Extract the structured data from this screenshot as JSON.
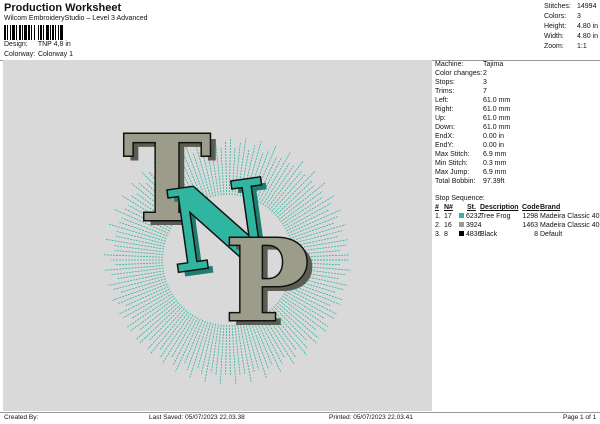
{
  "header": {
    "title": "Production Worksheet",
    "subtitle": "Wilcom EmbroideryStudio – Level 3 Advanced",
    "design_label": "Design:",
    "design_value": "TNP 4,8 in",
    "colorway_label": "Colorway:",
    "colorway_value": "Colorway 1"
  },
  "stats": [
    {
      "label": "Stitches:",
      "value": "14994"
    },
    {
      "label": "Colors:",
      "value": "3"
    },
    {
      "label": "Height:",
      "value": "4.80 in"
    },
    {
      "label": "Width:",
      "value": "4.80 in"
    },
    {
      "label": "Zoom:",
      "value": "1:1"
    }
  ],
  "details": [
    {
      "label": "Machine:",
      "value": "Tajima"
    },
    {
      "label": "Color changes:",
      "value": "2"
    },
    {
      "label": "Stops:",
      "value": "3"
    },
    {
      "label": "Trims:",
      "value": "7"
    },
    {
      "label": "Left:",
      "value": "61.0 mm"
    },
    {
      "label": "Right:",
      "value": "61.0 mm"
    },
    {
      "label": "Up:",
      "value": "61.0 mm"
    },
    {
      "label": "Down:",
      "value": "61.0 mm"
    },
    {
      "label": "EndX:",
      "value": "0.00 in"
    },
    {
      "label": "EndY:",
      "value": "0.00 in"
    },
    {
      "label": "Max Stitch:",
      "value": "6.9 mm"
    },
    {
      "label": "Min Stitch:",
      "value": "0.3 mm"
    },
    {
      "label": "Max Jump:",
      "value": "6.9 mm"
    },
    {
      "label": "Total Bobbin:",
      "value": "97.39ft"
    }
  ],
  "stop_sequence": {
    "title": "Stop Sequence:",
    "headers": {
      "num": "#",
      "n": "N#",
      "st": "St.",
      "desc": "Description",
      "code": "Code",
      "brand": "Brand"
    },
    "rows": [
      {
        "num": "1.",
        "n": "17",
        "color": "#2fb5a0",
        "code_num": "6232",
        "desc": "Tree Frog",
        "st": "1298",
        "brand": "Madeira Classic 40"
      },
      {
        "num": "2.",
        "n": "16",
        "color": "#9c9c8a",
        "code_num": "3924",
        "desc": "",
        "st": "1463",
        "brand": "Madeira Classic 40"
      },
      {
        "num": "3.",
        "n": "8",
        "color": "#000000",
        "code_num": "4836",
        "desc": "Black",
        "st": "8",
        "brand": "Default"
      }
    ]
  },
  "design": {
    "letter_t": "T",
    "letter_n": "N",
    "letter_p": "P",
    "colors": {
      "teal": "#2fb5a0",
      "khaki": "#9c9c8a",
      "outline": "#111111",
      "canvas": "#d9d9d9"
    }
  },
  "footer": {
    "created_by": "Created By:",
    "last_saved": "Last Saved: 05/07/2023 22.03.38",
    "printed": "Printed: 05/07/2023 22.03.41",
    "page": "Page 1 of 1"
  }
}
